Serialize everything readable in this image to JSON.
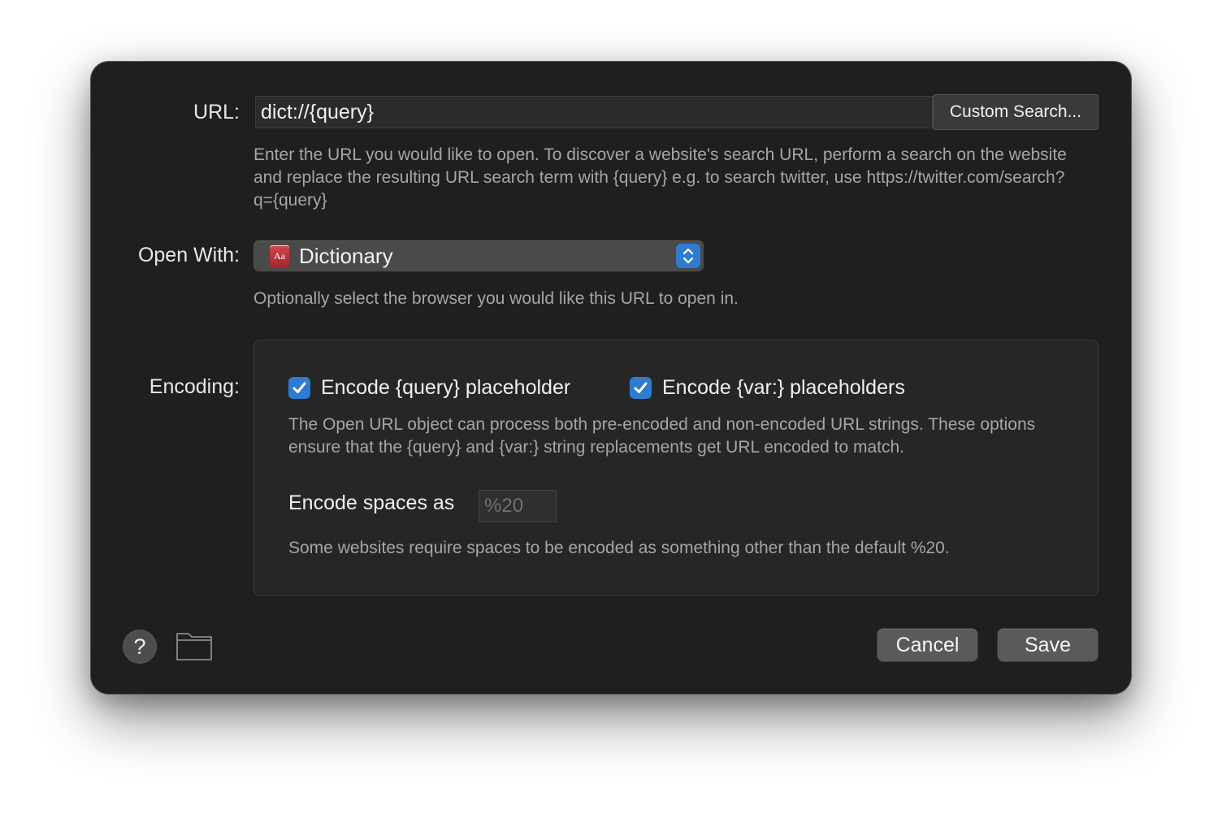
{
  "url": {
    "label": "URL:",
    "value": "dict://{query}",
    "custom_search_label": "Custom Search...",
    "help": "Enter the URL you would like to open. To discover a website's search URL, perform a search on the website and replace the resulting URL search term with {query} e.g. to search twitter, use https://twitter.com/search?q={query}"
  },
  "open_with": {
    "label": "Open With:",
    "selected": "Dictionary",
    "icon": "dictionary-app-icon",
    "icon_text": "Aa",
    "help": "Optionally select the browser you would like this URL to open in."
  },
  "encoding": {
    "label": "Encoding:",
    "encode_query": {
      "label": "Encode {query} placeholder",
      "checked": true
    },
    "encode_var": {
      "label": "Encode {var:} placeholders",
      "checked": true
    },
    "description": "The Open URL object can process both pre-encoded and non-encoded URL strings. These options ensure that the {query} and {var:} string replacements get URL encoded to match.",
    "spaces_label": "Encode spaces as",
    "spaces_value": "",
    "spaces_placeholder": "%20",
    "spaces_help": "Some websites require spaces to be encoded as something other than the default %20."
  },
  "footer": {
    "help_label": "?",
    "cancel_label": "Cancel",
    "save_label": "Save"
  },
  "colors": {
    "window_bg": "#1f1f1f",
    "accent": "#2e7bcf",
    "button_bg": "#5a5a5a"
  }
}
